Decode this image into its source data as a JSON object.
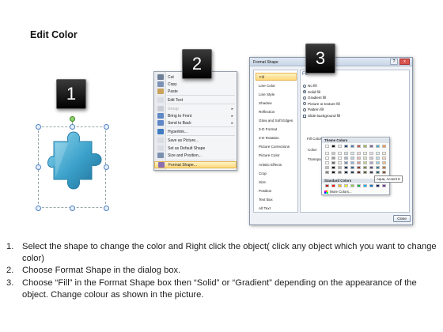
{
  "title": "Edit Color",
  "badges": [
    "1",
    "2",
    "3"
  ],
  "context_menu": {
    "items": [
      {
        "label": "Cut",
        "icon": "scissors-icon",
        "color": "#6d7e95",
        "disabled": false
      },
      {
        "label": "Copy",
        "icon": "copy-icon",
        "color": "#7c92b4",
        "disabled": false
      },
      {
        "label": "Paste",
        "icon": "clipboard-icon",
        "color": "#c9a35a",
        "disabled": false
      },
      {
        "label": "Edit Text",
        "icon": "edit-text-icon",
        "color": "#d8dde4",
        "disabled": false
      },
      {
        "label": "Group",
        "icon": "group-icon",
        "color": "#c9ced6",
        "disabled": true,
        "submenu": true
      },
      {
        "label": "Bring to Front",
        "icon": "bring-to-front-icon",
        "color": "#5f87c6",
        "disabled": false,
        "submenu": true
      },
      {
        "label": "Send to Back",
        "icon": "send-to-back-icon",
        "color": "#5f87c6",
        "disabled": false,
        "submenu": true
      },
      {
        "label": "Hyperlink...",
        "icon": "hyperlink-icon",
        "color": "#3f7bc0",
        "disabled": false
      },
      {
        "label": "Save as Picture...",
        "icon": "save-picture-icon",
        "color": "#d8dde4",
        "disabled": false
      },
      {
        "label": "Set as Default Shape",
        "icon": "default-shape-icon",
        "color": "#d8dde4",
        "disabled": false
      },
      {
        "label": "Size and Position...",
        "icon": "size-position-icon",
        "color": "#7b8fae",
        "disabled": false
      },
      {
        "label": "Format Shape...",
        "icon": "format-shape-icon",
        "color": "#8a6fb0",
        "disabled": false,
        "highlighted": true
      }
    ]
  },
  "dialog": {
    "title": "Format Shape",
    "help": "?",
    "close": "x",
    "categories": [
      "Fill",
      "Line Color",
      "Line Style",
      "Shadow",
      "Reflection",
      "Glow and Soft Edges",
      "3-D Format",
      "3-D Rotation",
      "Picture Corrections",
      "Picture Color",
      "Artistic Effects",
      "Crop",
      "Size",
      "Position",
      "Text Box",
      "Alt Text"
    ],
    "selected_category": "Fill",
    "pane_title": "Fill",
    "fill_options": [
      {
        "label": "No fill",
        "type": "radio",
        "on": false
      },
      {
        "label": "Solid fill",
        "type": "radio",
        "on": true
      },
      {
        "label": "Gradient fill",
        "type": "radio",
        "on": false
      },
      {
        "label": "Picture or texture fill",
        "type": "radio",
        "on": false
      },
      {
        "label": "Pattern fill",
        "type": "radio",
        "on": false
      },
      {
        "label": "Slide background fill",
        "type": "checkbox",
        "on": false
      }
    ],
    "fill_color_label": "Fill Color",
    "color_label": "Color:",
    "transparency_label": "Transpa",
    "close_button": "Close"
  },
  "color_picker": {
    "theme_header": "Theme Colors",
    "standard_header": "Standard Colors",
    "more_colors": "More Colors...",
    "tooltip": "Aqua, Accent 5",
    "theme_top": [
      "#ffffff",
      "#000000",
      "#eeece1",
      "#1f497d",
      "#4f81bd",
      "#c0504d",
      "#9bbb59",
      "#8064a2",
      "#4bacc6",
      "#f79646"
    ],
    "standard": [
      "#c00000",
      "#ff0000",
      "#ffc000",
      "#ffff00",
      "#92d050",
      "#00b050",
      "#00b0f0",
      "#0070c0",
      "#002060",
      "#7030a0"
    ]
  },
  "steps": [
    {
      "num": "1.",
      "text": "Select the shape to change the color and Right click the object( click any object which you want to change color)"
    },
    {
      "num": "2.",
      "text": "Choose Format Shape in the dialog box."
    },
    {
      "num": "3.",
      "text": "Choose “Fill” in the Format Shape box then “Solid” or “Gradient” depending on the appearance of the object. Change colour as shown in the picture."
    }
  ]
}
